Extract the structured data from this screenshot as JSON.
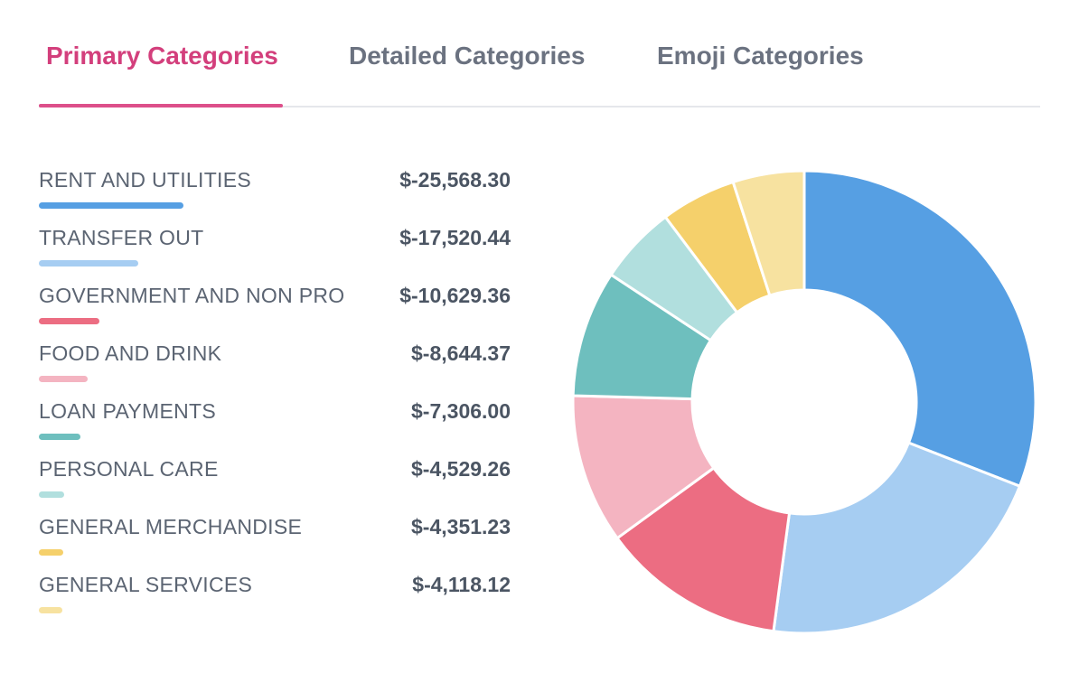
{
  "tabs": [
    {
      "label": "Primary Categories",
      "active": true
    },
    {
      "label": "Detailed Categories",
      "active": false
    },
    {
      "label": "Emoji Categories",
      "active": false
    }
  ],
  "colors": {
    "accent": "#d33f7c",
    "slices": [
      "#569fe3",
      "#a6cdf2",
      "#ec6d82",
      "#f4b4c1",
      "#6ebfbe",
      "#b1dfde",
      "#f5d06b",
      "#f7e2a0"
    ]
  },
  "chart_data": {
    "type": "donut",
    "categories": [
      "RENT AND UTILITIES",
      "TRANSFER OUT",
      "GOVERNMENT AND NON PRO",
      "FOOD AND DRINK",
      "LOAN PAYMENTS",
      "PERSONAL CARE",
      "GENERAL MERCHANDISE",
      "GENERAL SERVICES"
    ],
    "values": [
      -25568.3,
      -17520.44,
      -10629.36,
      -8644.37,
      -7306.0,
      -4529.26,
      -4351.23,
      -4118.12
    ],
    "value_labels": [
      "$-25,568.30",
      "$-17,520.44",
      "$-10,629.36",
      "$-8,644.37",
      "$-7,306.00",
      "$-4,529.26",
      "$-4,351.23",
      "$-4,118.12"
    ],
    "legend_placement": "left"
  }
}
